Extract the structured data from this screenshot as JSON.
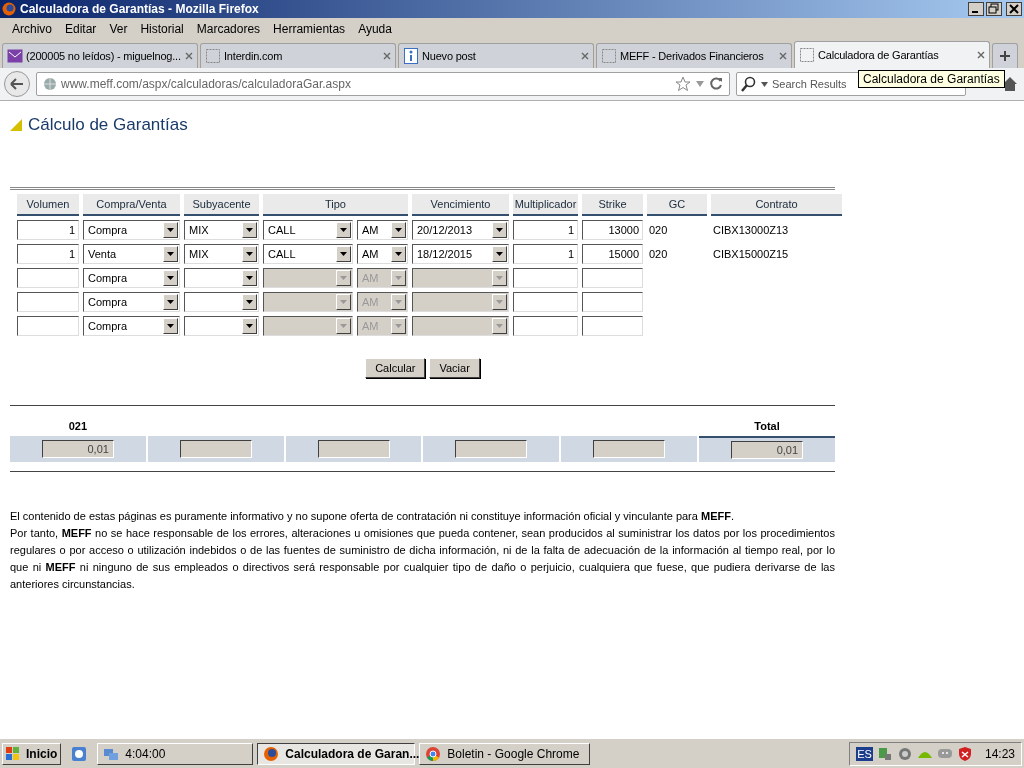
{
  "window": {
    "title": "Calculadora de Garantías - Mozilla Firefox"
  },
  "menu": [
    "Archivo",
    "Editar",
    "Ver",
    "Historial",
    "Marcadores",
    "Herramientas",
    "Ayuda"
  ],
  "tabs": [
    {
      "label": "(200005 no leídos) - miguelnog...",
      "selected": false
    },
    {
      "label": "Interdin.com",
      "selected": false
    },
    {
      "label": "Nuevo post",
      "selected": false
    },
    {
      "label": "MEFF - Derivados Financieros",
      "selected": false
    },
    {
      "label": "Calculadora de Garantías",
      "selected": true
    }
  ],
  "address": {
    "value": "www.meff.com/aspx/calculadoras/calculadoraGar.aspx"
  },
  "search": {
    "placeholder": "Search Results"
  },
  "tooltip": "Calculadora de Garantías",
  "page_title": "Cálculo de Garantías",
  "table": {
    "columns": [
      "Volumen",
      "Compra/Venta",
      "Subyacente",
      "Tipo",
      "Vencimiento",
      "Multiplicador",
      "Strike",
      "GC",
      "Contrato"
    ],
    "rows": [
      {
        "volumen": "1",
        "compra_venta": "Compra",
        "subyacente": "MIX",
        "tipo": "CALL",
        "ejercicio": "AM",
        "vencimiento": "20/12/2013",
        "multiplicador": "1",
        "strike": "13000",
        "gc": "020",
        "contrato": "CIBX13000Z13",
        "disabled": false
      },
      {
        "volumen": "1",
        "compra_venta": "Venta",
        "subyacente": "MIX",
        "tipo": "CALL",
        "ejercicio": "AM",
        "vencimiento": "18/12/2015",
        "multiplicador": "1",
        "strike": "15000",
        "gc": "020",
        "contrato": "CIBX15000Z15",
        "disabled": false
      },
      {
        "compra_venta": "Compra",
        "ejercicio": "AM",
        "disabled": true
      },
      {
        "compra_venta": "Compra",
        "ejercicio": "AM",
        "disabled": true
      },
      {
        "compra_venta": "Compra",
        "ejercicio": "AM",
        "disabled": true
      }
    ]
  },
  "buttons": [
    "Calcular",
    "Vaciar"
  ],
  "results": {
    "group_label": "021",
    "total_label": "Total",
    "fields": [
      {
        "kind": "value",
        "value": "0,01"
      },
      {
        "kind": "empty"
      },
      {
        "kind": "empty"
      },
      {
        "kind": "empty"
      },
      {
        "kind": "empty"
      },
      {
        "kind": "total",
        "value": "0,01"
      }
    ]
  },
  "disclaimer": [
    "El contenido de estas páginas es puramente informativo y no supone oferta de contratación ni constituye información oficial y vinculante para **MEFF**.",
    "Por tanto, **MEFF** no se hace responsable de los errores, alteraciones u omisiones que pueda contener, sean producidos al suministrar los datos por los procedimientos regulares o por acceso o utilización indebidos o de las fuentes de suministro de dicha información, ni de la falta de adecuación de la información al tiempo real, por lo que ni **MEFF** ni ninguno de sus empleados o directivos será responsable por cualquier tipo de daño o perjuicio, cualquiera que fuese, que pudiera derivarse de las anteriores circunstancias."
  ],
  "taskbar": {
    "start": "Inicio",
    "items": [
      {
        "label": "4:04:00",
        "selected": false
      },
      {
        "label": "Calculadora de Garan...",
        "selected": true
      },
      {
        "label": "Boletin - Google Chrome",
        "selected": false
      }
    ],
    "language": "ES",
    "clock": "14:23"
  }
}
